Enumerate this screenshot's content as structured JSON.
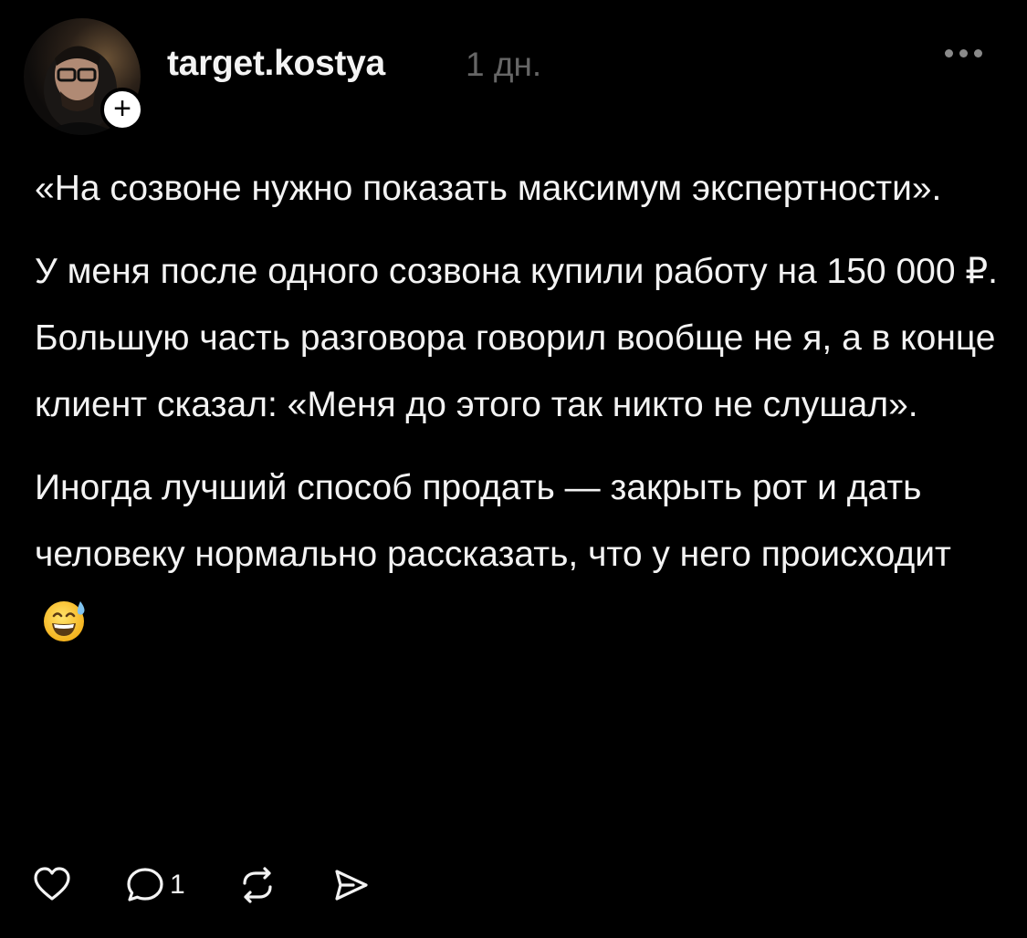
{
  "post": {
    "username": "target.kostya",
    "time_ago": "1 дн.",
    "paragraphs": [
      "«На созвоне нужно показать максимум экспертности».",
      "У меня после одного созвона купили работу на 150 000 ₽.",
      "Большую часть разговора говорил вообще не я, а в конце клиент сказал: «Меня до этого так никто не слушал».",
      "Иногда лучший способ продать — закрыть рот и дать человеку нормально рассказать, что у него происходит"
    ],
    "emoji": "sweat-smile-emoji"
  },
  "actions": {
    "like_icon": "heart-icon",
    "reply_icon": "comment-icon",
    "reply_count": "1",
    "repost_icon": "repost-icon",
    "share_icon": "send-icon"
  },
  "colors": {
    "background": "#000000",
    "text": "#f3f3f3",
    "muted": "#666666"
  }
}
